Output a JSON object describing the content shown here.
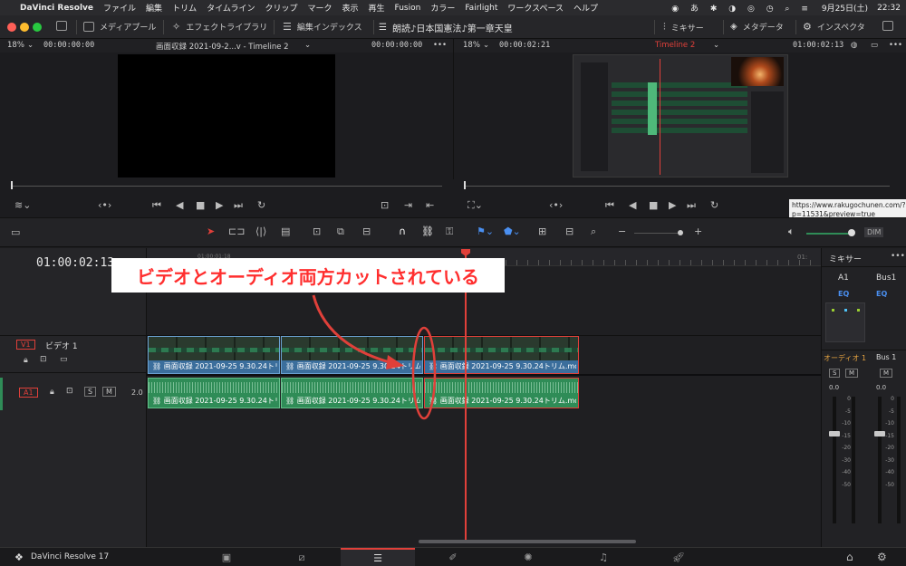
{
  "menubar": {
    "apple": "",
    "app_name": "DaVinci Resolve",
    "items": [
      "ファイル",
      "編集",
      "トリム",
      "タイムライン",
      "クリップ",
      "マーク",
      "表示",
      "再生",
      "Fusion",
      "カラー",
      "Fairlight",
      "ワークスペース",
      "ヘルプ"
    ],
    "date": "9月25日(土)",
    "time": "22:32"
  },
  "toolbar": {
    "media_pool": "メディアプール",
    "effects_library": "エフェクトライブラリ",
    "edit_index": "編集インデックス",
    "project_title": "朗読♪日本国憲法♪第一章天皇",
    "mixer": "ミキサー",
    "metadata": "メタデータ",
    "inspector": "インスペクタ"
  },
  "source_viewer": {
    "zoom": "18%",
    "timecode_left": "00:00:00:00",
    "clip_name": "画面収録 2021-09-2...v - Timeline 2",
    "timecode_right": "00:00:00:00",
    "more": "•••"
  },
  "timeline_viewer": {
    "zoom": "18%",
    "timecode_left": "00:00:02:21",
    "timeline_name": "Timeline 2",
    "timecode_right": "01:00:02:13",
    "more": "•••"
  },
  "tooltip": {
    "text": "https://www.rakugochunen.com/?p=11531&preview=true"
  },
  "timeline": {
    "current_timecode": "01:00:02:13",
    "ruler_marks": [
      "01:00:01:18",
      "01:"
    ],
    "video_track": {
      "id": "V1",
      "name": "ビデオ 1"
    },
    "audio_track": {
      "id": "A1",
      "solo": "S",
      "mute": "M",
      "level": "2.0"
    },
    "clips": [
      {
        "video_label": "画面収録 2021-09-25 9.30.24トリ...",
        "audio_label": "画面収録 2021-09-25 9.30.24トリ..."
      },
      {
        "video_label": "画面収録 2021-09-25 9.30.24トリム...",
        "audio_label": "画面収録 2021-09-25 9.30.24トリム..."
      },
      {
        "video_label": "画面収録 2021-09-25 9.30.24トリム.mov",
        "audio_label": "画面収録 2021-09-25 9.30.24トリム.mov"
      }
    ]
  },
  "annotation": {
    "text": "ビデオとオーディオ両方カットされている",
    "color": "#ff2e2e"
  },
  "mixer_panel": {
    "title": "ミキサー",
    "more": "•••",
    "channel_a1": "A1",
    "channel_bus1": "Bus1",
    "eq": "EQ",
    "track_name": "オーディオ 1",
    "bus_name": "Bus 1",
    "s_label": "S",
    "m_label": "M",
    "level_a1": "0.0",
    "level_bus": "0.0",
    "scale": [
      "0",
      "-5",
      "-10",
      "-15",
      "-20",
      "-30",
      "-40",
      "-50"
    ]
  },
  "bottombar": {
    "app_version": "DaVinci Resolve 17"
  },
  "colors": {
    "accent_red": "#e0403a",
    "video_clip": "#3b6e9c",
    "audio_clip": "#2f8c57",
    "playhead": "#e0403a"
  }
}
